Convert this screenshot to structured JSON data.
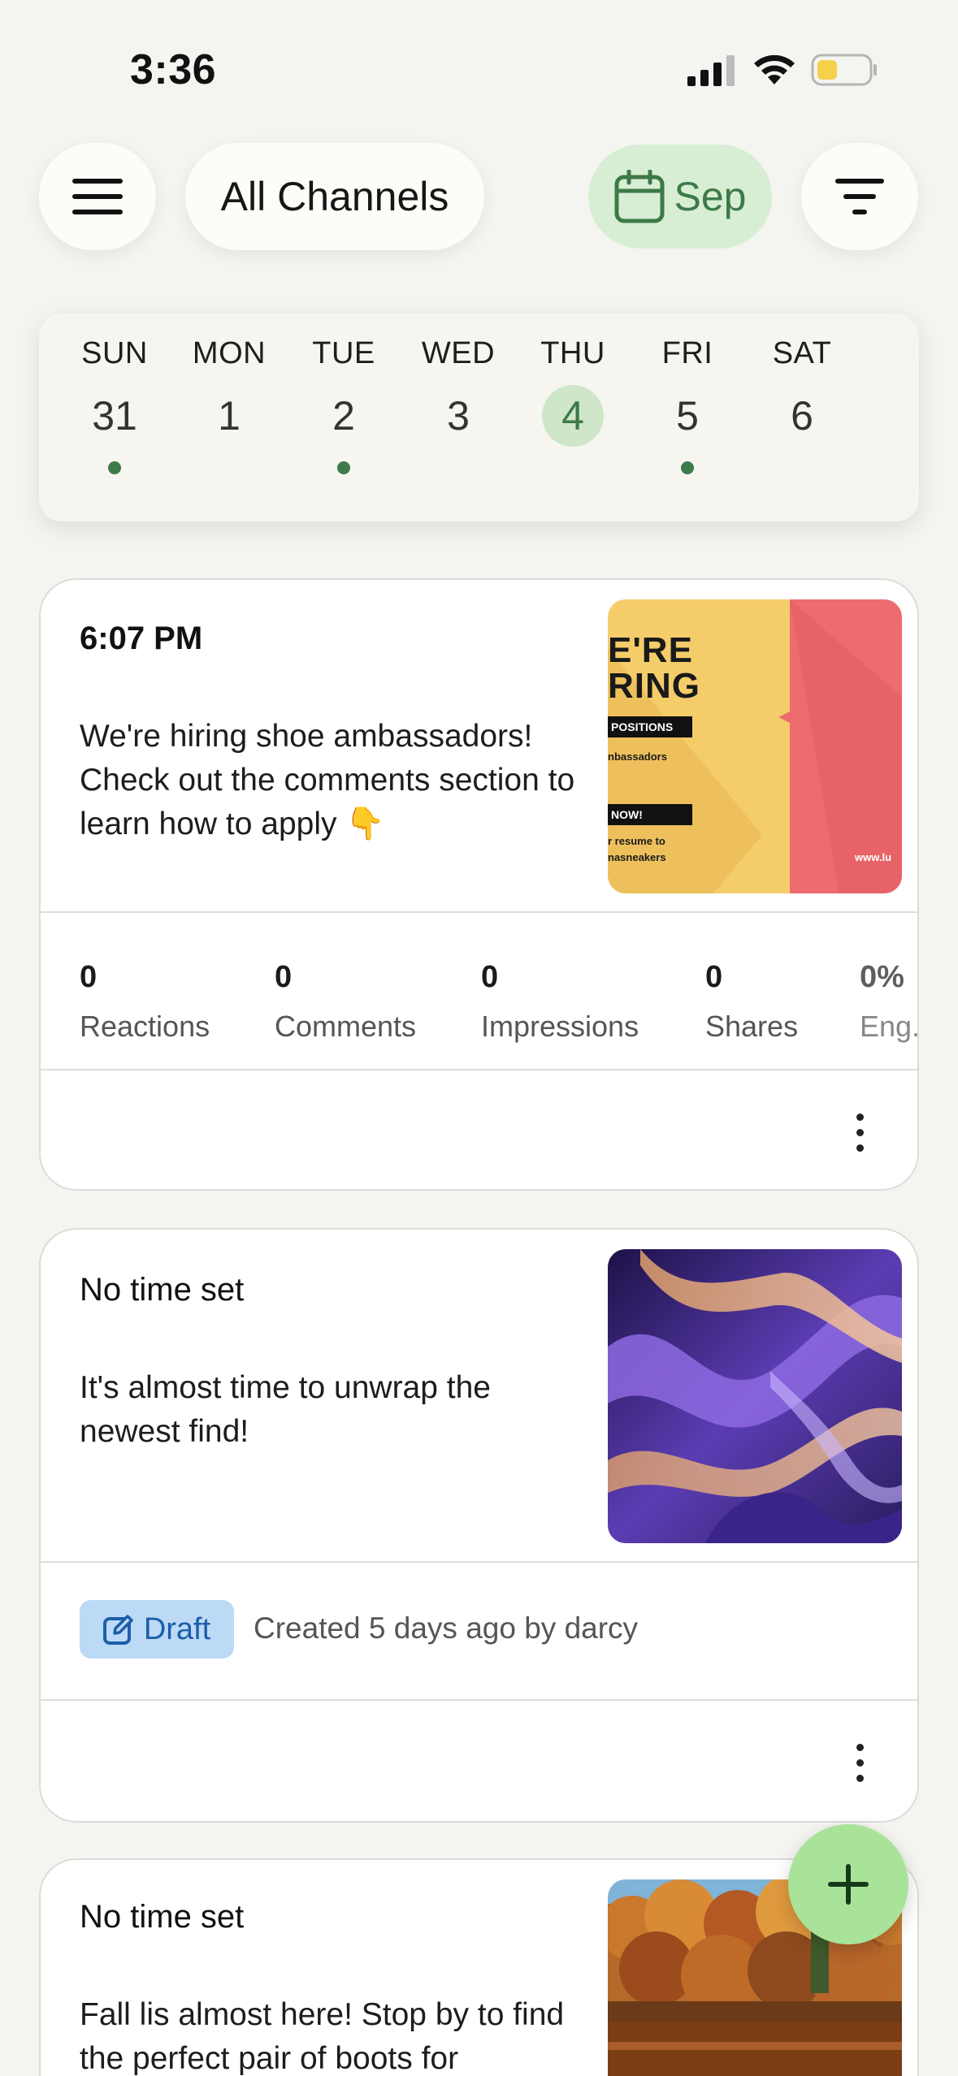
{
  "status_bar": {
    "time": "3:36"
  },
  "toolbar": {
    "channel_filter": "All Channels",
    "month": "Sep"
  },
  "week": {
    "days": [
      {
        "name": "SUN",
        "num": "31",
        "has_posts": true,
        "selected": false
      },
      {
        "name": "MON",
        "num": "1",
        "has_posts": false,
        "selected": false
      },
      {
        "name": "TUE",
        "num": "2",
        "has_posts": true,
        "selected": false
      },
      {
        "name": "WED",
        "num": "3",
        "has_posts": false,
        "selected": false
      },
      {
        "name": "THU",
        "num": "4",
        "has_posts": false,
        "selected": true
      },
      {
        "name": "FRI",
        "num": "5",
        "has_posts": true,
        "selected": false
      },
      {
        "name": "SAT",
        "num": "6",
        "has_posts": false,
        "selected": false
      }
    ]
  },
  "posts": [
    {
      "time": "6:07 PM",
      "text": "We're hiring shoe ambassadors! Check out the comments section to learn how to apply 👇",
      "thumbnail": {
        "kind": "hiring-poster",
        "title_line1": "E'RE",
        "title_line2": "RING",
        "bar1": "POSITIONS",
        "line1": "nbassadors",
        "bar2": "NOW!",
        "line2": "r resume to",
        "line3": "nasneakers",
        "url": "www.lu"
      },
      "stats": [
        {
          "value": "0",
          "label": "Reactions"
        },
        {
          "value": "0",
          "label": "Comments"
        },
        {
          "value": "0",
          "label": "Impressions"
        },
        {
          "value": "0",
          "label": "Shares"
        },
        {
          "value": "0%",
          "label": "Eng."
        }
      ]
    },
    {
      "time": "No time set",
      "text": "It's almost time to unwrap the newest find!",
      "thumbnail": {
        "kind": "abstract-purple-chrome"
      },
      "status": "Draft",
      "meta": "Created 5 days ago by darcy"
    },
    {
      "time": "No time set",
      "text": "Fall lis almost here! Stop by to find the perfect pair of boots for",
      "thumbnail": {
        "kind": "autumn-forest-lake"
      }
    }
  ],
  "colors": {
    "accent_green": "#3c7a47",
    "accent_green_bg": "#d8eed4",
    "fab_green": "#a9e39a",
    "draft_blue": "#1c5ea8",
    "draft_bg": "#bcdaf6"
  },
  "icons": {
    "menu": "hamburger-menu-icon",
    "calendar": "calendar-icon",
    "filter": "filter-icon",
    "more": "more-vertical-icon",
    "edit": "edit-icon",
    "add": "plus-icon"
  }
}
